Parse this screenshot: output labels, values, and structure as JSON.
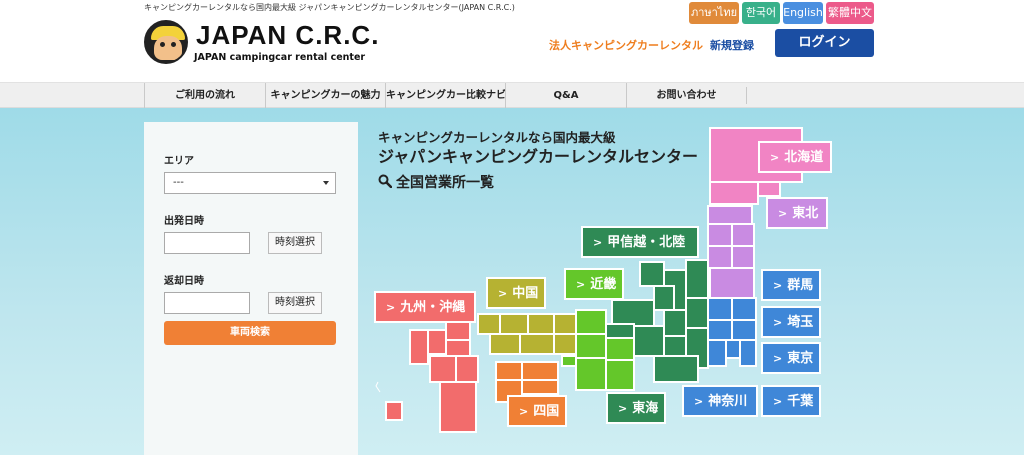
{
  "header": {
    "tagline": "キャンピングカーレンタルなら国内最大級 ジャパンキャンピングカーレンタルセンター(JAPAN C.R.C.)",
    "logo_text": "JAPAN C.R.C.",
    "logo_sub": "JAPAN campingcar rental center",
    "languages": [
      {
        "label": "ภาษาไทย",
        "color": "#e08a3a"
      },
      {
        "label": "한국어",
        "color": "#38b08a"
      },
      {
        "label": "English",
        "color": "#4a8fe0"
      },
      {
        "label": "繁體中文",
        "color": "#ec5a8a"
      }
    ],
    "corporate_link": "法人キャンピングカーレンタル",
    "register_link": "新規登録",
    "login_button": "ログイン"
  },
  "nav": {
    "items": [
      "ご利用の流れ",
      "キャンピングカーの魅力",
      "キャンピングカー比較ナビ",
      "Q&A",
      "お問い合わせ"
    ]
  },
  "search": {
    "area_label": "エリア",
    "area_value": "---",
    "depart_label": "出発日時",
    "return_label": "返却日時",
    "time_select": "時刻選択",
    "search_button": "車両検索"
  },
  "hero": {
    "line1": "キャンピングカーレンタルなら国内最大級",
    "line2": "ジャパンキャンピングカーレンタルセンター",
    "line3": "全国営業所一覧"
  },
  "regions": {
    "hokkaido": "北海道",
    "tohoku": "東北",
    "koshinetsu": "甲信越・北陸",
    "gunma": "群馬",
    "saitama": "埼玉",
    "tokyo": "東京",
    "kanagawa": "神奈川",
    "chiba": "千葉",
    "tokai": "東海",
    "kinki": "近畿",
    "chugoku": "中国",
    "shikoku": "四国",
    "kyushu": "九州・沖縄"
  },
  "colors": {
    "hokkaido": "#f184c4",
    "tohoku": "#c98be2",
    "koshinetsu": "#2f8a55",
    "kanto": "#3f87d8",
    "tokai": "#2f8a55",
    "kinki": "#64c72a",
    "chugoku": "#b6b232",
    "shikoku": "#f08035",
    "kyushu": "#f26c6c",
    "login": "#1b4ea3",
    "corporate_link": "#ee7d1e",
    "register_link": "#1b4ea3"
  }
}
